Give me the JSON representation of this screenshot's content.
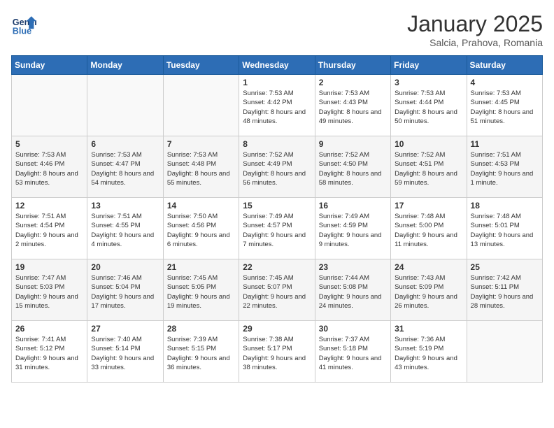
{
  "header": {
    "logo_line1": "General",
    "logo_line2": "Blue",
    "month": "January 2025",
    "location": "Salcia, Prahova, Romania"
  },
  "days_of_week": [
    "Sunday",
    "Monday",
    "Tuesday",
    "Wednesday",
    "Thursday",
    "Friday",
    "Saturday"
  ],
  "weeks": [
    [
      {
        "day": "",
        "sunrise": "",
        "sunset": "",
        "daylight": ""
      },
      {
        "day": "",
        "sunrise": "",
        "sunset": "",
        "daylight": ""
      },
      {
        "day": "",
        "sunrise": "",
        "sunset": "",
        "daylight": ""
      },
      {
        "day": "1",
        "sunrise": "Sunrise: 7:53 AM",
        "sunset": "Sunset: 4:42 PM",
        "daylight": "Daylight: 8 hours and 48 minutes."
      },
      {
        "day": "2",
        "sunrise": "Sunrise: 7:53 AM",
        "sunset": "Sunset: 4:43 PM",
        "daylight": "Daylight: 8 hours and 49 minutes."
      },
      {
        "day": "3",
        "sunrise": "Sunrise: 7:53 AM",
        "sunset": "Sunset: 4:44 PM",
        "daylight": "Daylight: 8 hours and 50 minutes."
      },
      {
        "day": "4",
        "sunrise": "Sunrise: 7:53 AM",
        "sunset": "Sunset: 4:45 PM",
        "daylight": "Daylight: 8 hours and 51 minutes."
      }
    ],
    [
      {
        "day": "5",
        "sunrise": "Sunrise: 7:53 AM",
        "sunset": "Sunset: 4:46 PM",
        "daylight": "Daylight: 8 hours and 53 minutes."
      },
      {
        "day": "6",
        "sunrise": "Sunrise: 7:53 AM",
        "sunset": "Sunset: 4:47 PM",
        "daylight": "Daylight: 8 hours and 54 minutes."
      },
      {
        "day": "7",
        "sunrise": "Sunrise: 7:53 AM",
        "sunset": "Sunset: 4:48 PM",
        "daylight": "Daylight: 8 hours and 55 minutes."
      },
      {
        "day": "8",
        "sunrise": "Sunrise: 7:52 AM",
        "sunset": "Sunset: 4:49 PM",
        "daylight": "Daylight: 8 hours and 56 minutes."
      },
      {
        "day": "9",
        "sunrise": "Sunrise: 7:52 AM",
        "sunset": "Sunset: 4:50 PM",
        "daylight": "Daylight: 8 hours and 58 minutes."
      },
      {
        "day": "10",
        "sunrise": "Sunrise: 7:52 AM",
        "sunset": "Sunset: 4:51 PM",
        "daylight": "Daylight: 8 hours and 59 minutes."
      },
      {
        "day": "11",
        "sunrise": "Sunrise: 7:51 AM",
        "sunset": "Sunset: 4:53 PM",
        "daylight": "Daylight: 9 hours and 1 minute."
      }
    ],
    [
      {
        "day": "12",
        "sunrise": "Sunrise: 7:51 AM",
        "sunset": "Sunset: 4:54 PM",
        "daylight": "Daylight: 9 hours and 2 minutes."
      },
      {
        "day": "13",
        "sunrise": "Sunrise: 7:51 AM",
        "sunset": "Sunset: 4:55 PM",
        "daylight": "Daylight: 9 hours and 4 minutes."
      },
      {
        "day": "14",
        "sunrise": "Sunrise: 7:50 AM",
        "sunset": "Sunset: 4:56 PM",
        "daylight": "Daylight: 9 hours and 6 minutes."
      },
      {
        "day": "15",
        "sunrise": "Sunrise: 7:49 AM",
        "sunset": "Sunset: 4:57 PM",
        "daylight": "Daylight: 9 hours and 7 minutes."
      },
      {
        "day": "16",
        "sunrise": "Sunrise: 7:49 AM",
        "sunset": "Sunset: 4:59 PM",
        "daylight": "Daylight: 9 hours and 9 minutes."
      },
      {
        "day": "17",
        "sunrise": "Sunrise: 7:48 AM",
        "sunset": "Sunset: 5:00 PM",
        "daylight": "Daylight: 9 hours and 11 minutes."
      },
      {
        "day": "18",
        "sunrise": "Sunrise: 7:48 AM",
        "sunset": "Sunset: 5:01 PM",
        "daylight": "Daylight: 9 hours and 13 minutes."
      }
    ],
    [
      {
        "day": "19",
        "sunrise": "Sunrise: 7:47 AM",
        "sunset": "Sunset: 5:03 PM",
        "daylight": "Daylight: 9 hours and 15 minutes."
      },
      {
        "day": "20",
        "sunrise": "Sunrise: 7:46 AM",
        "sunset": "Sunset: 5:04 PM",
        "daylight": "Daylight: 9 hours and 17 minutes."
      },
      {
        "day": "21",
        "sunrise": "Sunrise: 7:45 AM",
        "sunset": "Sunset: 5:05 PM",
        "daylight": "Daylight: 9 hours and 19 minutes."
      },
      {
        "day": "22",
        "sunrise": "Sunrise: 7:45 AM",
        "sunset": "Sunset: 5:07 PM",
        "daylight": "Daylight: 9 hours and 22 minutes."
      },
      {
        "day": "23",
        "sunrise": "Sunrise: 7:44 AM",
        "sunset": "Sunset: 5:08 PM",
        "daylight": "Daylight: 9 hours and 24 minutes."
      },
      {
        "day": "24",
        "sunrise": "Sunrise: 7:43 AM",
        "sunset": "Sunset: 5:09 PM",
        "daylight": "Daylight: 9 hours and 26 minutes."
      },
      {
        "day": "25",
        "sunrise": "Sunrise: 7:42 AM",
        "sunset": "Sunset: 5:11 PM",
        "daylight": "Daylight: 9 hours and 28 minutes."
      }
    ],
    [
      {
        "day": "26",
        "sunrise": "Sunrise: 7:41 AM",
        "sunset": "Sunset: 5:12 PM",
        "daylight": "Daylight: 9 hours and 31 minutes."
      },
      {
        "day": "27",
        "sunrise": "Sunrise: 7:40 AM",
        "sunset": "Sunset: 5:14 PM",
        "daylight": "Daylight: 9 hours and 33 minutes."
      },
      {
        "day": "28",
        "sunrise": "Sunrise: 7:39 AM",
        "sunset": "Sunset: 5:15 PM",
        "daylight": "Daylight: 9 hours and 36 minutes."
      },
      {
        "day": "29",
        "sunrise": "Sunrise: 7:38 AM",
        "sunset": "Sunset: 5:17 PM",
        "daylight": "Daylight: 9 hours and 38 minutes."
      },
      {
        "day": "30",
        "sunrise": "Sunrise: 7:37 AM",
        "sunset": "Sunset: 5:18 PM",
        "daylight": "Daylight: 9 hours and 41 minutes."
      },
      {
        "day": "31",
        "sunrise": "Sunrise: 7:36 AM",
        "sunset": "Sunset: 5:19 PM",
        "daylight": "Daylight: 9 hours and 43 minutes."
      },
      {
        "day": "",
        "sunrise": "",
        "sunset": "",
        "daylight": ""
      }
    ]
  ]
}
